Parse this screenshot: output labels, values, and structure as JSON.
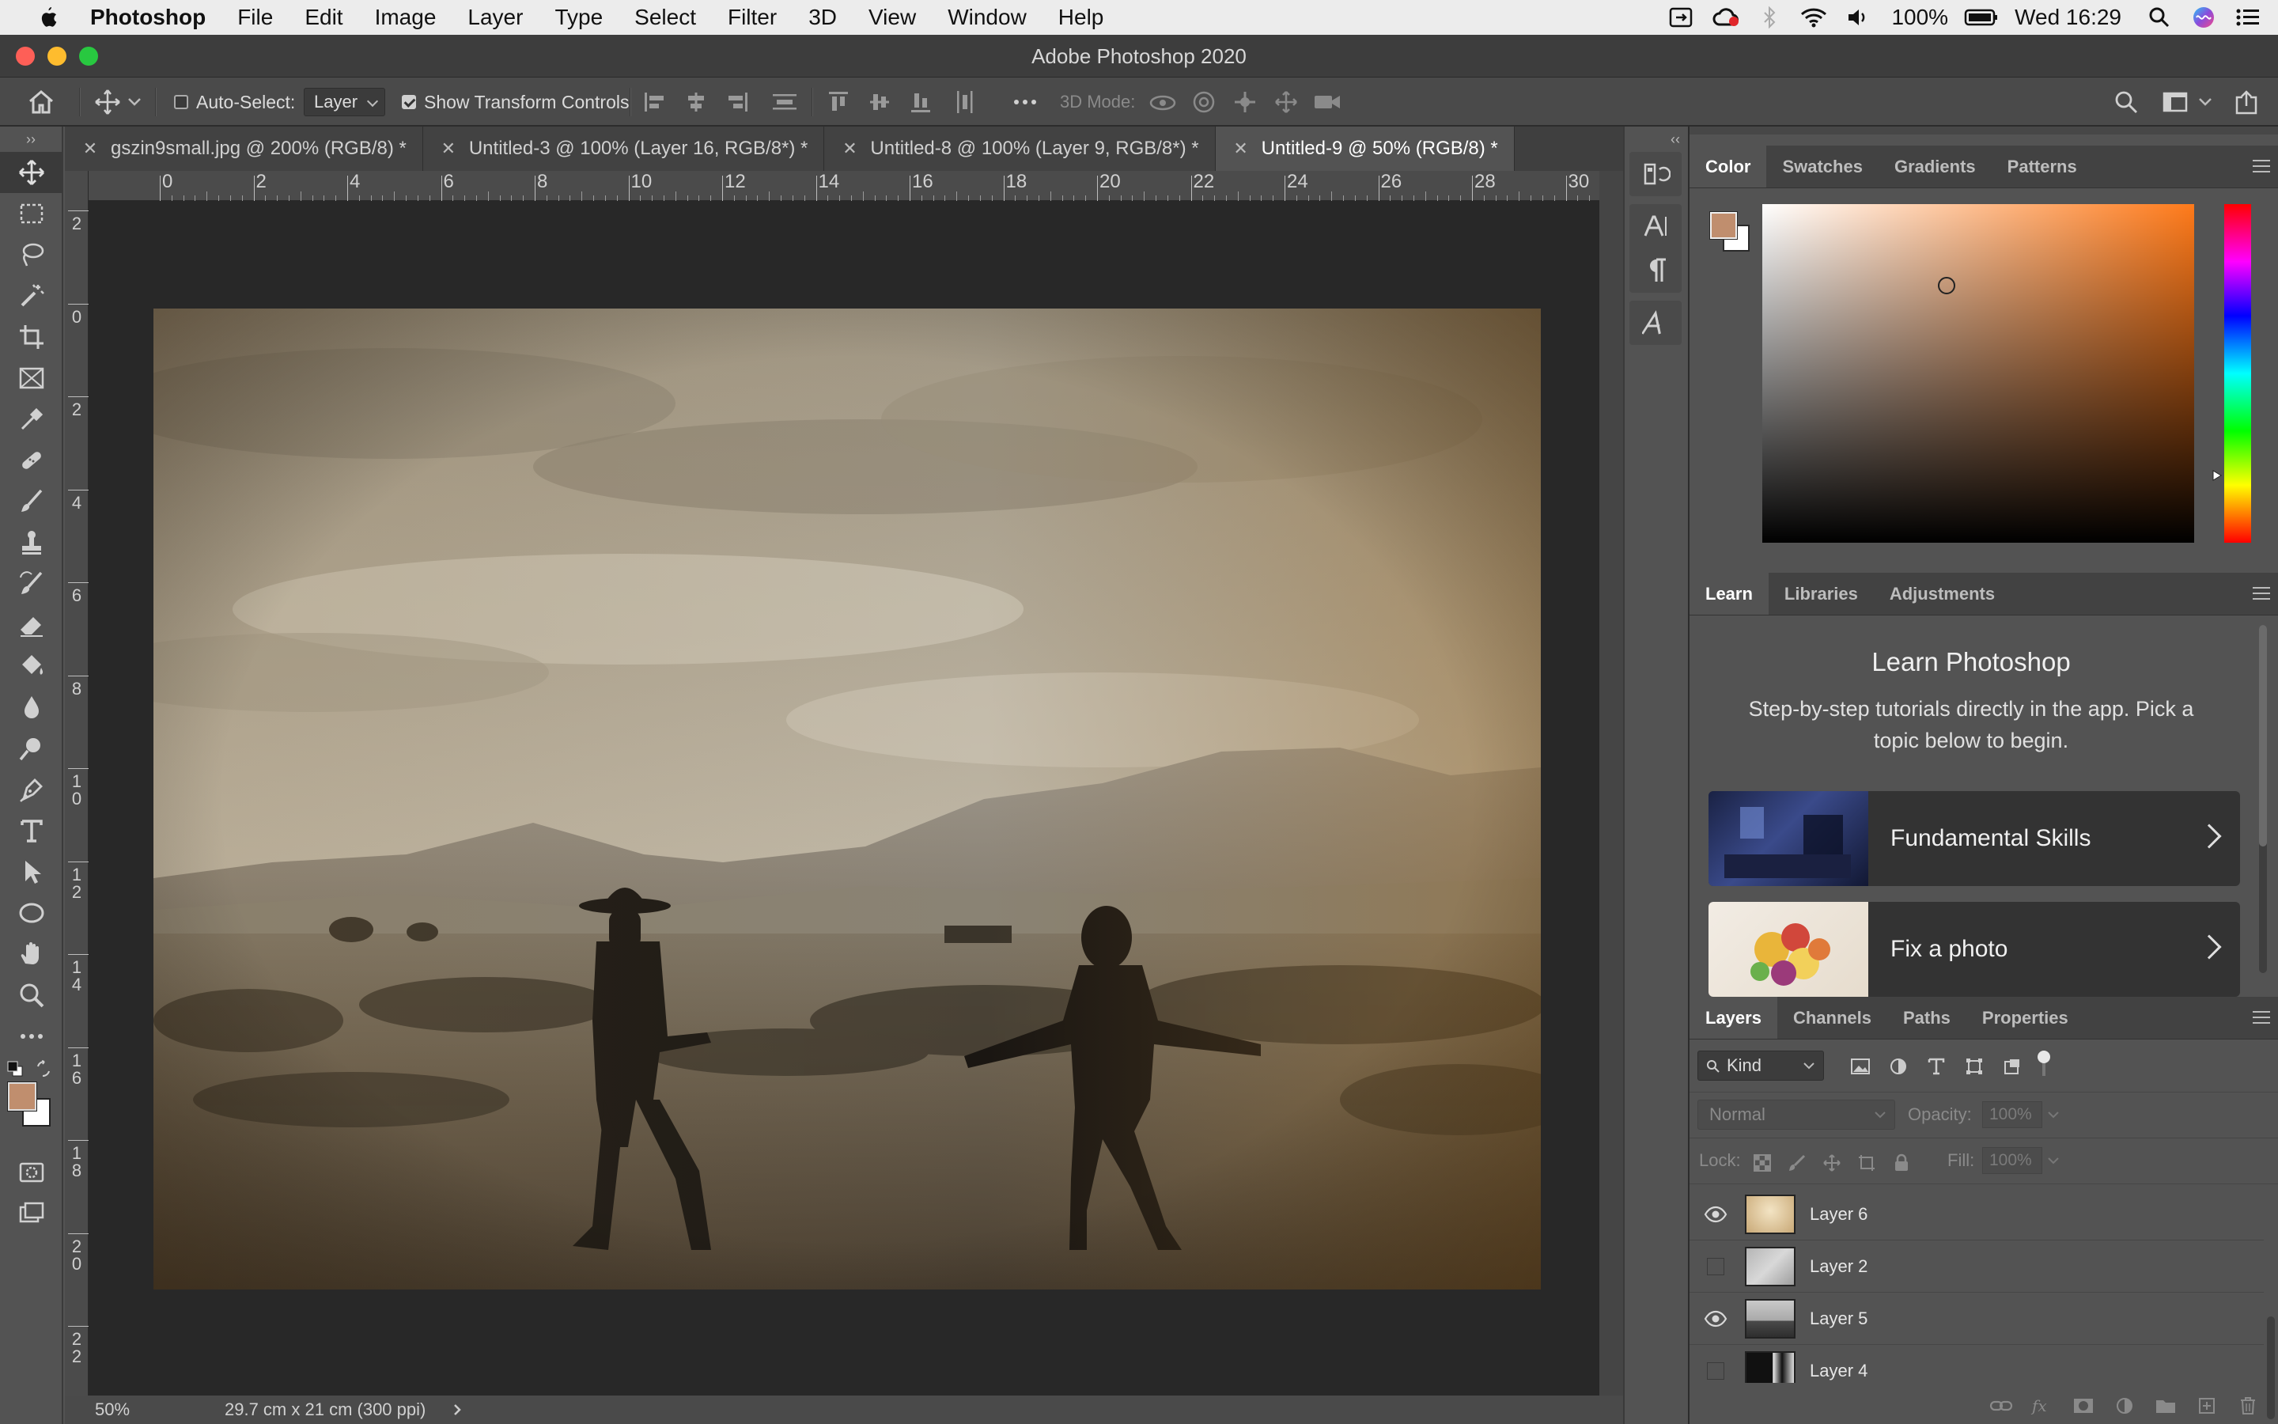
{
  "menubar": {
    "app_name": "Photoshop",
    "items": [
      "File",
      "Edit",
      "Image",
      "Layer",
      "Type",
      "Select",
      "Filter",
      "3D",
      "View",
      "Window",
      "Help"
    ],
    "battery": "100%",
    "clock": "Wed 16:29"
  },
  "window": {
    "title": "Adobe Photoshop 2020"
  },
  "options": {
    "auto_select_label": "Auto-Select:",
    "auto_select_value": "Layer",
    "show_transform_label": "Show Transform Controls",
    "mode_3d_label": "3D Mode:"
  },
  "tabs": [
    {
      "label": "gszin9small.jpg @ 200% (RGB/8) *",
      "active": false
    },
    {
      "label": "Untitled-3 @ 100% (Layer 16, RGB/8*) *",
      "active": false
    },
    {
      "label": "Untitled-8 @ 100% (Layer 9, RGB/8*) *",
      "active": false
    },
    {
      "label": "Untitled-9 @ 50% (RGB/8) *",
      "active": true
    }
  ],
  "ruler": {
    "h_ticks": [
      "0",
      "2",
      "4",
      "6",
      "8",
      "10",
      "12",
      "14",
      "16",
      "18",
      "20",
      "22",
      "24",
      "26",
      "28",
      "30"
    ],
    "v_ticks": [
      "2",
      "0",
      "2",
      "4",
      "6",
      "8",
      "1\n0",
      "1\n2",
      "1\n4",
      "1\n6",
      "1\n8",
      "2\n0",
      "2\n2"
    ]
  },
  "status": {
    "zoom": "50%",
    "doc_size": "29.7 cm x 21 cm (300 ppi)"
  },
  "colors": {
    "foreground": "#c08e6e",
    "background": "#ffffff",
    "picker_hue": "#ff7a1a",
    "accent": "#3d8ee8"
  },
  "color_panel": {
    "tabs": [
      "Color",
      "Swatches",
      "Gradients",
      "Patterns"
    ],
    "active": "Color"
  },
  "learn_panel": {
    "tabs": [
      "Learn",
      "Libraries",
      "Adjustments"
    ],
    "active": "Learn",
    "heading": "Learn Photoshop",
    "description_line1": "Step-by-step tutorials directly in the app. Pick a",
    "description_line2": "topic below to begin.",
    "cards": [
      "Fundamental Skills",
      "Fix a photo"
    ]
  },
  "layers_panel": {
    "tabs": [
      "Layers",
      "Channels",
      "Paths",
      "Properties"
    ],
    "active": "Layers",
    "filter_kind": "Kind",
    "blend_mode": "Normal",
    "opacity_label": "Opacity:",
    "opacity_value": "100%",
    "lock_label": "Lock:",
    "fill_label": "Fill:",
    "fill_value": "100%",
    "layers": [
      {
        "name": "Layer 6",
        "visible": true
      },
      {
        "name": "Layer 2",
        "visible": false
      },
      {
        "name": "Layer 5",
        "visible": true
      },
      {
        "name": "Layer 4",
        "visible": false
      }
    ]
  },
  "tool_icons": [
    "move-tool-icon",
    "marquee-tool-icon",
    "lasso-tool-icon",
    "magic-wand-tool-icon",
    "crop-tool-icon",
    "frame-tool-icon",
    "eyedropper-tool-icon",
    "healing-brush-tool-icon",
    "brush-tool-icon",
    "clone-stamp-tool-icon",
    "history-brush-tool-icon",
    "eraser-tool-icon",
    "paint-bucket-tool-icon",
    "blur-tool-icon",
    "dodge-tool-icon",
    "pen-tool-icon",
    "type-tool-icon",
    "path-selection-tool-icon",
    "ellipse-tool-icon",
    "hand-tool-icon",
    "zoom-tool-icon",
    "more-tools-icon"
  ]
}
